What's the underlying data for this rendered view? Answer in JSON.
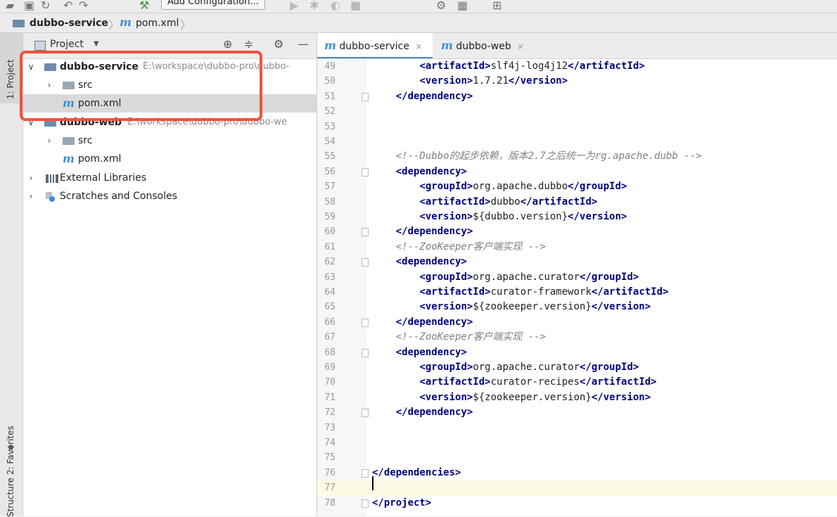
{
  "toolbar": {
    "add_config_label": "Add Configuration..."
  },
  "breadcrumbs": {
    "project": "dubbo-service",
    "file": "pom.xml"
  },
  "left_strip": {
    "project_tab": "1: Project",
    "favorites_tab": "2: Favorites",
    "structure_tab": "Structure"
  },
  "project_panel": {
    "title": "Project",
    "tree": [
      {
        "label": "dubbo-service",
        "path": "E:\\workspace\\dubbo-pro\\dubbo-"
      },
      {
        "label": "src"
      },
      {
        "label": "pom.xml"
      },
      {
        "label": "dubbo-web",
        "path": "E:\\workspace\\dubbo-pro\\dubbo-we"
      },
      {
        "label": "src"
      },
      {
        "label": "pom.xml"
      },
      {
        "label": "External Libraries"
      },
      {
        "label": "Scratches and Consoles"
      }
    ]
  },
  "editor": {
    "tabs": [
      {
        "label": "dubbo-service",
        "active": true
      },
      {
        "label": "dubbo-web",
        "active": false
      }
    ],
    "lines": [
      {
        "n": "49",
        "t": "        <artifactId>slf4j-log4j12</artifactId>"
      },
      {
        "n": "50",
        "t": "        <version>1.7.21</version>"
      },
      {
        "n": "51",
        "t": "    </dependency>"
      },
      {
        "n": "52",
        "t": ""
      },
      {
        "n": "53",
        "t": ""
      },
      {
        "n": "54",
        "t": ""
      },
      {
        "n": "55",
        "t": "    <!--Dubbo的起步依赖，版本2.7之后统一为rg.apache.dubb -->"
      },
      {
        "n": "56",
        "t": "    <dependency>"
      },
      {
        "n": "57",
        "t": "        <groupId>org.apache.dubbo</groupId>"
      },
      {
        "n": "58",
        "t": "        <artifactId>dubbo</artifactId>"
      },
      {
        "n": "59",
        "t": "        <version>${dubbo.version}</version>"
      },
      {
        "n": "60",
        "t": "    </dependency>"
      },
      {
        "n": "61",
        "t": "    <!--ZooKeeper客户端实现 -->"
      },
      {
        "n": "62",
        "t": "    <dependency>"
      },
      {
        "n": "63",
        "t": "        <groupId>org.apache.curator</groupId>"
      },
      {
        "n": "64",
        "t": "        <artifactId>curator-framework</artifactId>"
      },
      {
        "n": "65",
        "t": "        <version>${zookeeper.version}</version>"
      },
      {
        "n": "66",
        "t": "    </dependency>"
      },
      {
        "n": "67",
        "t": "    <!--ZooKeeper客户端实现 -->"
      },
      {
        "n": "68",
        "t": "    <dependency>"
      },
      {
        "n": "69",
        "t": "        <groupId>org.apache.curator</groupId>"
      },
      {
        "n": "70",
        "t": "        <artifactId>curator-recipes</artifactId>"
      },
      {
        "n": "71",
        "t": "        <version>${zookeeper.version}</version>"
      },
      {
        "n": "72",
        "t": "    </dependency>"
      },
      {
        "n": "73",
        "t": ""
      },
      {
        "n": "74",
        "t": ""
      },
      {
        "n": "75",
        "t": ""
      },
      {
        "n": "76",
        "t": "</dependencies>"
      },
      {
        "n": "77",
        "t": ""
      },
      {
        "n": "78",
        "t": "</project>"
      }
    ]
  },
  "colors": {
    "accent": "#4a88c7",
    "highlight_box": "#f0523a",
    "maven_icon": "#3d8edb"
  }
}
